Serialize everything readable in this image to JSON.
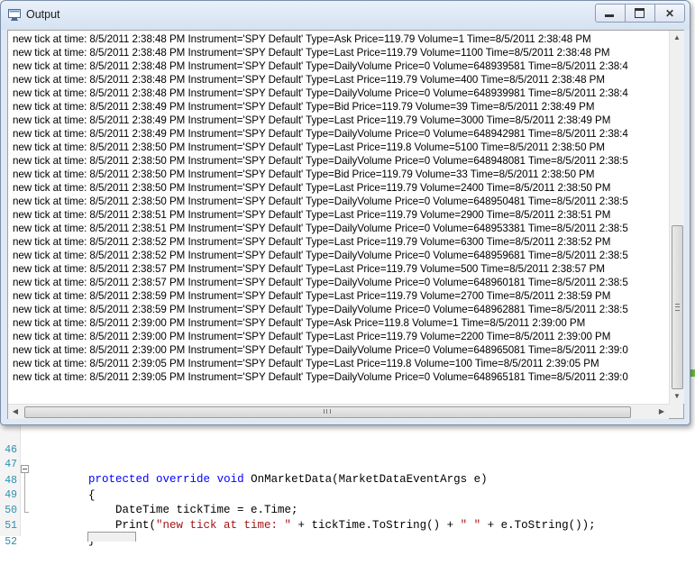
{
  "window": {
    "title": "Output",
    "close_glyph": "✕",
    "log_lines": [
      "new tick at time: 8/5/2011 2:38:48 PM Instrument='SPY Default' Type=Ask Price=119.79 Volume=1 Time=8/5/2011 2:38:48 PM",
      "new tick at time: 8/5/2011 2:38:48 PM Instrument='SPY Default' Type=Last Price=119.79 Volume=1100 Time=8/5/2011 2:38:48 PM",
      "new tick at time: 8/5/2011 2:38:48 PM Instrument='SPY Default' Type=DailyVolume Price=0 Volume=648939581 Time=8/5/2011 2:38:4",
      "new tick at time: 8/5/2011 2:38:48 PM Instrument='SPY Default' Type=Last Price=119.79 Volume=400 Time=8/5/2011 2:38:48 PM",
      "new tick at time: 8/5/2011 2:38:48 PM Instrument='SPY Default' Type=DailyVolume Price=0 Volume=648939981 Time=8/5/2011 2:38:4",
      "new tick at time: 8/5/2011 2:38:49 PM Instrument='SPY Default' Type=Bid Price=119.79 Volume=39 Time=8/5/2011 2:38:49 PM",
      "new tick at time: 8/5/2011 2:38:49 PM Instrument='SPY Default' Type=Last Price=119.79 Volume=3000 Time=8/5/2011 2:38:49 PM",
      "new tick at time: 8/5/2011 2:38:49 PM Instrument='SPY Default' Type=DailyVolume Price=0 Volume=648942981 Time=8/5/2011 2:38:4",
      "new tick at time: 8/5/2011 2:38:50 PM Instrument='SPY Default' Type=Last Price=119.8 Volume=5100 Time=8/5/2011 2:38:50 PM",
      "new tick at time: 8/5/2011 2:38:50 PM Instrument='SPY Default' Type=DailyVolume Price=0 Volume=648948081 Time=8/5/2011 2:38:5",
      "new tick at time: 8/5/2011 2:38:50 PM Instrument='SPY Default' Type=Bid Price=119.79 Volume=33 Time=8/5/2011 2:38:50 PM",
      "new tick at time: 8/5/2011 2:38:50 PM Instrument='SPY Default' Type=Last Price=119.79 Volume=2400 Time=8/5/2011 2:38:50 PM",
      "new tick at time: 8/5/2011 2:38:50 PM Instrument='SPY Default' Type=DailyVolume Price=0 Volume=648950481 Time=8/5/2011 2:38:5",
      "new tick at time: 8/5/2011 2:38:51 PM Instrument='SPY Default' Type=Last Price=119.79 Volume=2900 Time=8/5/2011 2:38:51 PM",
      "new tick at time: 8/5/2011 2:38:51 PM Instrument='SPY Default' Type=DailyVolume Price=0 Volume=648953381 Time=8/5/2011 2:38:5",
      "new tick at time: 8/5/2011 2:38:52 PM Instrument='SPY Default' Type=Last Price=119.79 Volume=6300 Time=8/5/2011 2:38:52 PM",
      "new tick at time: 8/5/2011 2:38:52 PM Instrument='SPY Default' Type=DailyVolume Price=0 Volume=648959681 Time=8/5/2011 2:38:5",
      "new tick at time: 8/5/2011 2:38:57 PM Instrument='SPY Default' Type=Last Price=119.79 Volume=500 Time=8/5/2011 2:38:57 PM",
      "new tick at time: 8/5/2011 2:38:57 PM Instrument='SPY Default' Type=DailyVolume Price=0 Volume=648960181 Time=8/5/2011 2:38:5",
      "new tick at time: 8/5/2011 2:38:59 PM Instrument='SPY Default' Type=Last Price=119.79 Volume=2700 Time=8/5/2011 2:38:59 PM",
      "new tick at time: 8/5/2011 2:38:59 PM Instrument='SPY Default' Type=DailyVolume Price=0 Volume=648962881 Time=8/5/2011 2:38:5",
      "new tick at time: 8/5/2011 2:39:00 PM Instrument='SPY Default' Type=Ask Price=119.8 Volume=1 Time=8/5/2011 2:39:00 PM",
      "new tick at time: 8/5/2011 2:39:00 PM Instrument='SPY Default' Type=Last Price=119.79 Volume=2200 Time=8/5/2011 2:39:00 PM",
      "new tick at time: 8/5/2011 2:39:00 PM Instrument='SPY Default' Type=DailyVolume Price=0 Volume=648965081 Time=8/5/2011 2:39:0",
      "new tick at time: 8/5/2011 2:39:05 PM Instrument='SPY Default' Type=Last Price=119.8 Volume=100 Time=8/5/2011 2:39:05 PM",
      "new tick at time: 8/5/2011 2:39:05 PM Instrument='SPY Default' Type=DailyVolume Price=0 Volume=648965181 Time=8/5/2011 2:39:0"
    ]
  },
  "scroll": {
    "up_glyph": "▲",
    "down_glyph": "▼",
    "left_glyph": "◀",
    "right_glyph": "▶"
  },
  "editor": {
    "line_numbers": [
      "46",
      "47",
      "48",
      "49",
      "50",
      "51",
      "52"
    ],
    "line47": {
      "kw1": "protected",
      "kw2": "override",
      "kw3": "void",
      "rest": " OnMarketData(MarketDataEventArgs e)"
    },
    "line48": "{",
    "line49": "    DateTime tickTime = e.Time;",
    "line50": {
      "pre": "    Print(",
      "str1": "\"new tick at time: \"",
      "mid": " + tickTime.ToString() + ",
      "str2": "\" \"",
      "post": " + e.ToString());"
    },
    "line51": "}"
  },
  "icons": {
    "title": "output-window-icon"
  }
}
